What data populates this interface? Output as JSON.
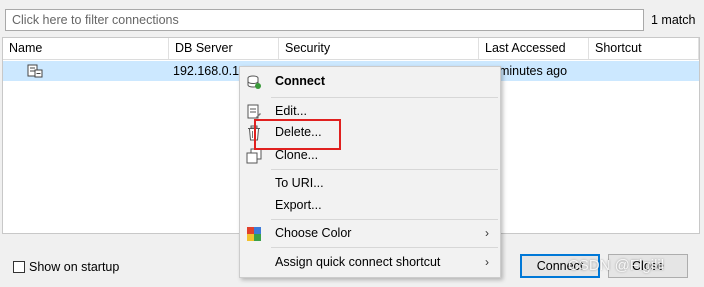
{
  "filter": {
    "placeholder": "Click here to filter connections",
    "match_count": "1 match"
  },
  "table": {
    "columns": [
      "Name",
      "DB Server",
      "Security",
      "Last Accessed",
      "Shortcut"
    ],
    "rows": [
      {
        "name": "",
        "db_server": "192.168.0.1",
        "security": "",
        "last_accessed": "… minutes ago",
        "shortcut": ""
      }
    ]
  },
  "context_menu": {
    "items": [
      {
        "label": "Connect",
        "icon": "database-connect-icon"
      },
      {
        "label": "Edit...",
        "icon": "edit-document-icon"
      },
      {
        "label": "Delete...",
        "icon": "trash-icon"
      },
      {
        "label": "Clone...",
        "icon": "clone-icon"
      },
      {
        "label": "To URI..."
      },
      {
        "label": "Export..."
      },
      {
        "label": "Choose Color",
        "icon": "color-palette-icon"
      },
      {
        "label": "Assign quick connect shortcut"
      }
    ]
  },
  "footer": {
    "show_on_startup": "Show on startup",
    "connect_label": "Connect",
    "close_label": "Close",
    "watermark": "CSDN @Flgilil"
  },
  "colors": {
    "selection": "#cce8ff",
    "menu_background": "#f2f2f2",
    "highlight_border": "#e0201f",
    "default_button_border": "#0078d7"
  }
}
